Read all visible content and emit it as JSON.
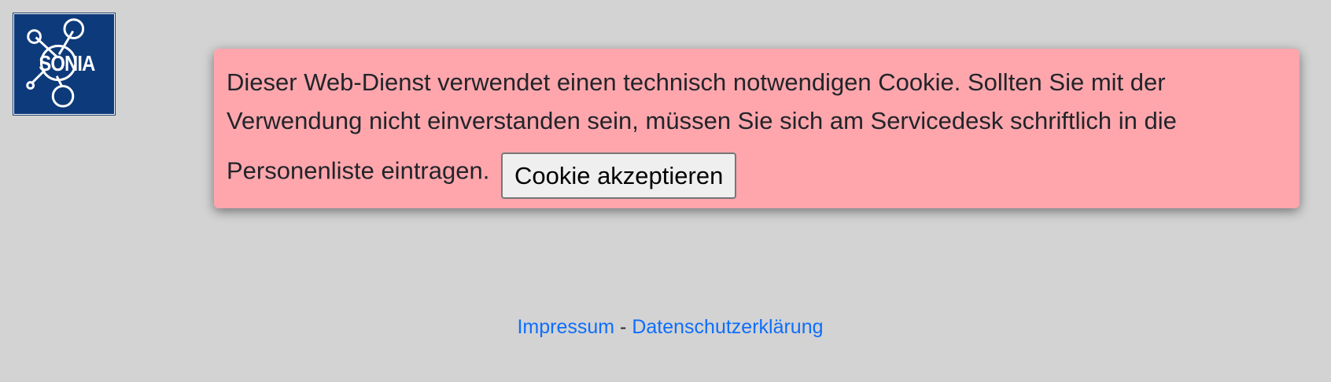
{
  "logo": {
    "text": "SONIA",
    "icon": "network-molecule-icon",
    "background_color": "#0d3a7a"
  },
  "cookie_banner": {
    "message": "Dieser Web-Dienst verwendet einen technisch notwendigen Cookie. Sollten Sie mit der Verwendung nicht einverstanden sein, müssen Sie sich am Servicedesk schriftlich in die Personenliste eintragen.",
    "accept_label": "Cookie akzeptieren",
    "background_color": "#ffa6ad"
  },
  "footer": {
    "impressum_label": "Impressum",
    "separator": "-",
    "privacy_label": "Datenschutzerklärung",
    "link_color": "#0d6efd"
  },
  "page": {
    "background_color": "#d3d3d3"
  }
}
